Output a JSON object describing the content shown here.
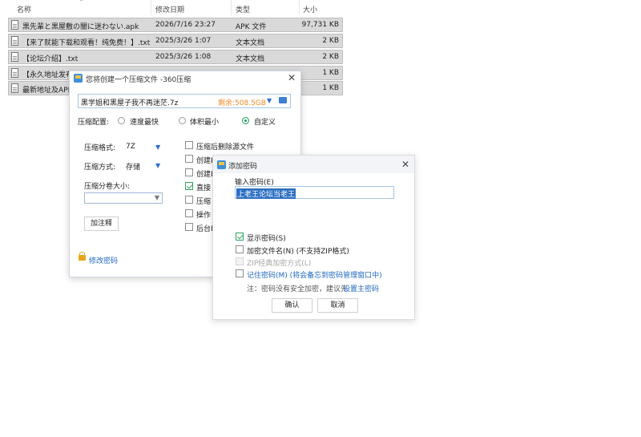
{
  "explorer": {
    "columns": {
      "name": "名称",
      "date": "修改日期",
      "type": "类型",
      "size": "大小"
    },
    "rows": [
      {
        "name": "黒先輩と黒屋敷の闇に迷わない.apk",
        "date": "2026/7/16 23:27",
        "type": "APK 文件",
        "size": "97,731 KB"
      },
      {
        "name": "【来了就能下载和观看！纯免费！】.txt",
        "date": "2025/3/26 1:07",
        "type": "文本文档",
        "size": "2 KB"
      },
      {
        "name": "【论坛介绍】.txt",
        "date": "2025/3/26 1:08",
        "type": "文本文档",
        "size": "2 KB"
      },
      {
        "name": "【永久地址发布",
        "size": "1 KB"
      },
      {
        "name": "最新地址及APP",
        "size": "1 KB"
      }
    ]
  },
  "compress_dialog": {
    "title": "您将创建一个压缩文件 -360压缩",
    "path_value": "黑学姐和黑屋子我不再迷茫.7z",
    "free_space": "剩余:508.5GB",
    "config_label": "压缩配置:",
    "config_options": [
      "速度最快",
      "体积最小",
      "自定义"
    ],
    "format_label": "压缩格式:",
    "format_value": "7Z",
    "method_label": "压缩方式:",
    "method_value": "存储",
    "split_label": "压缩分卷大小:",
    "comment_button": "加注释",
    "change_password": "修改密码",
    "options": [
      "压缩后删除源文件",
      "创建E",
      "创建E",
      "直接",
      "压缩",
      "操作",
      "后台E"
    ],
    "option_checked": [
      false,
      false,
      false,
      true,
      false,
      false,
      false
    ]
  },
  "password_dialog": {
    "title": "添加密码",
    "input_label": "输入密码(E)",
    "input_value": "上老王论坛当老王",
    "show_password": "显示密码(S)",
    "encrypt_filenames": "加密文件名(N) (不支持ZIP格式)",
    "zip_classic": "ZIP经典加密方式(L)",
    "remember_password": "记住密码(M) (将会备忘到密码管理窗口中)",
    "note_prefix": "注：密码没有安全加密，建议先",
    "note_link": "设置主密码",
    "ok": "确认",
    "cancel": "取消"
  },
  "colors": {
    "accent": "#1f67c4",
    "free_space": "#f08a24",
    "check": "#2fa35f"
  }
}
